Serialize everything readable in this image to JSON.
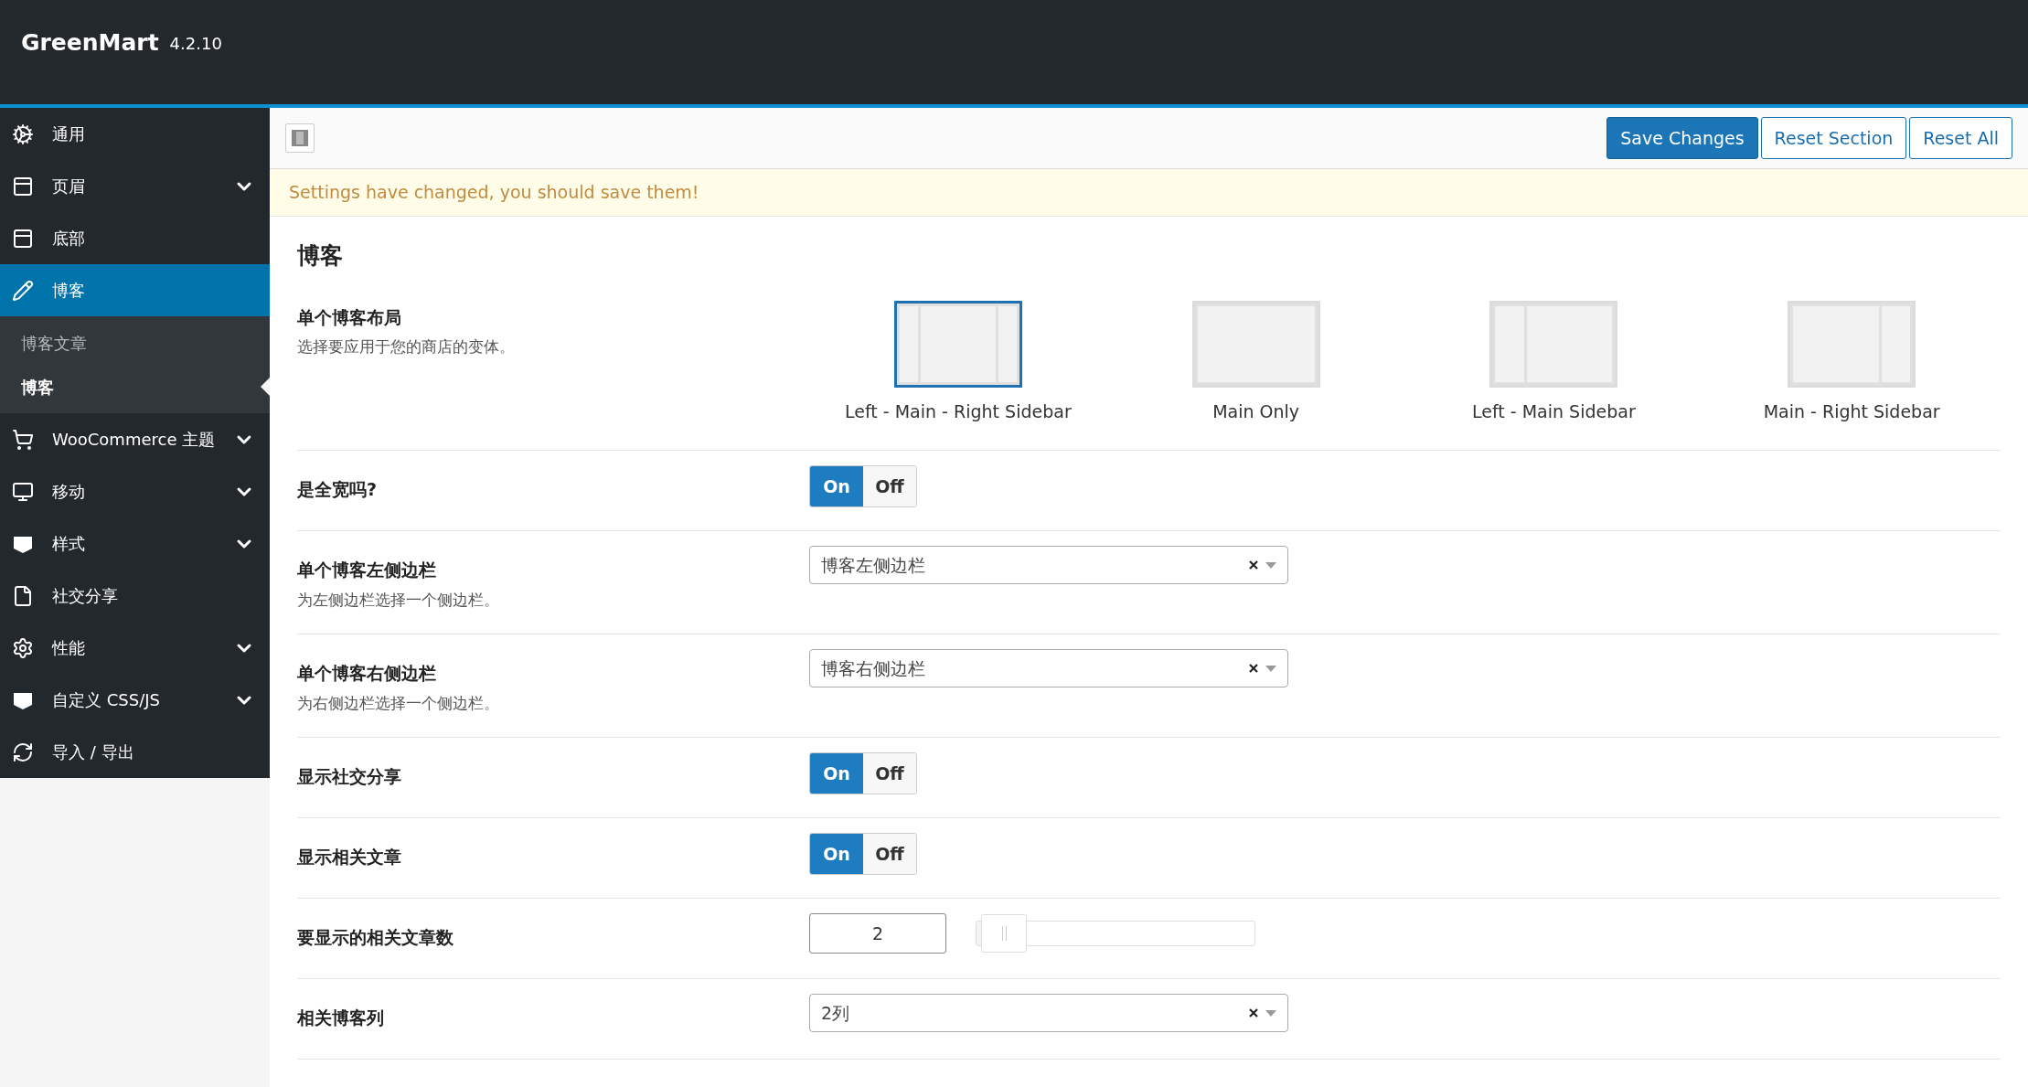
{
  "header": {
    "title": "GreenMart",
    "version": "4.2.10"
  },
  "sidebar": {
    "items": [
      {
        "label": "通用",
        "has_submenu": false,
        "selected": false
      },
      {
        "label": "页眉",
        "has_submenu": true,
        "selected": false
      },
      {
        "label": "底部",
        "has_submenu": false,
        "selected": false
      },
      {
        "label": "博客",
        "has_submenu": false,
        "selected": true,
        "children": [
          {
            "label": "博客文章",
            "selected": false
          },
          {
            "label": "博客",
            "selected": true
          }
        ]
      },
      {
        "label": "WooCommerce 主题",
        "has_submenu": true,
        "selected": false
      },
      {
        "label": "移动",
        "has_submenu": true,
        "selected": false
      },
      {
        "label": "样式",
        "has_submenu": true,
        "selected": false
      },
      {
        "label": "社交分享",
        "has_submenu": false,
        "selected": false
      },
      {
        "label": "性能",
        "has_submenu": true,
        "selected": false
      },
      {
        "label": "自定义 CSS/JS",
        "has_submenu": true,
        "selected": false
      },
      {
        "label": "导入 / 导出",
        "has_submenu": false,
        "selected": false
      }
    ]
  },
  "toolbar": {
    "buttons": [
      {
        "label": "Save Changes",
        "kind": "primary"
      },
      {
        "label": "Reset Section",
        "kind": "secondary"
      },
      {
        "label": "Reset All",
        "kind": "secondary"
      }
    ]
  },
  "notice": "Settings have changed, you should save them!",
  "section_title": "博客",
  "fields": [
    {
      "kind": "layout",
      "label": "单个博客布局",
      "description": "选择要应用于您的商店的变体。",
      "options": [
        {
          "label": "Left - Main - Right Sidebar",
          "selected": true
        },
        {
          "label": "Main Only",
          "selected": false
        },
        {
          "label": "Left - Main Sidebar",
          "selected": false
        },
        {
          "label": "Main - Right Sidebar",
          "selected": false
        }
      ]
    },
    {
      "kind": "switch",
      "label": "是全宽吗?",
      "on_label": "On",
      "off_label": "Off",
      "on": true
    },
    {
      "kind": "select",
      "label": "单个博客左侧边栏",
      "description": "为左侧边栏选择一个侧边栏。",
      "value": "博客左侧边栏"
    },
    {
      "kind": "select",
      "label": "单个博客右侧边栏",
      "description": "为右侧边栏选择一个侧边栏。",
      "value": "博客右侧边栏"
    },
    {
      "kind": "switch",
      "label": "显示社交分享",
      "on_label": "On",
      "off_label": "Off",
      "on": true
    },
    {
      "kind": "switch",
      "label": "显示相关文章",
      "on_label": "On",
      "off_label": "Off",
      "on": true
    },
    {
      "kind": "slider",
      "label": "要显示的相关文章数",
      "value": "2",
      "level": 0.02
    },
    {
      "kind": "select",
      "label": "相关博客列",
      "value": "2列"
    }
  ]
}
